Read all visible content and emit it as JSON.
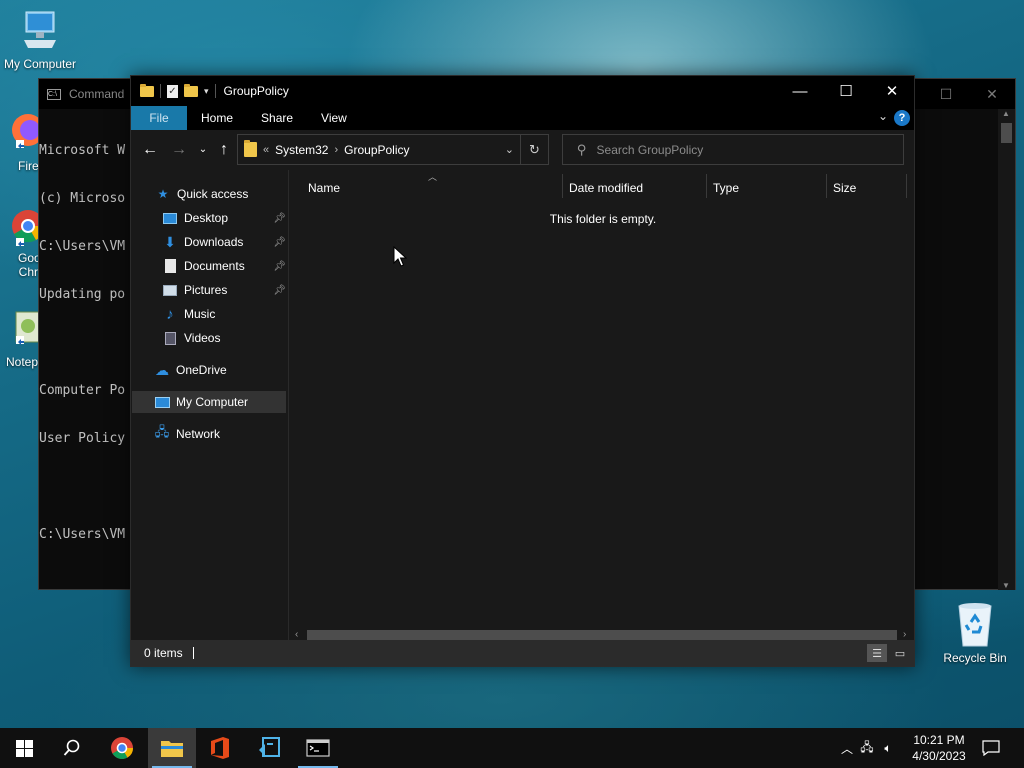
{
  "desktop": {
    "icons": [
      {
        "label": "My Computer"
      },
      {
        "label": "Fire"
      },
      {
        "label": "Goo"
      },
      {
        "label": "Chr"
      },
      {
        "label": "Notep"
      },
      {
        "label": "Recycle Bin"
      }
    ]
  },
  "cmd_window": {
    "title": "Command",
    "lines": [
      "Microsoft W",
      "(c) Microso",
      "C:\\Users\\VM",
      "Updating po",
      "",
      "Computer Po",
      "User Policy",
      "",
      "C:\\Users\\VM"
    ]
  },
  "explorer": {
    "title": "GroupPolicy",
    "ribbon_tabs": [
      "File",
      "Home",
      "Share",
      "View"
    ],
    "breadcrumb": {
      "overflow": "«",
      "items": [
        "System32",
        "GroupPolicy"
      ]
    },
    "search_placeholder": "Search GroupPolicy",
    "nav": {
      "quick_access": "Quick access",
      "pinned": [
        "Desktop",
        "Downloads",
        "Documents",
        "Pictures"
      ],
      "unpinned": [
        "Music",
        "Videos"
      ],
      "onedrive": "OneDrive",
      "my_computer": "My Computer",
      "network": "Network"
    },
    "columns": [
      "Name",
      "Date modified",
      "Type",
      "Size"
    ],
    "empty_message": "This folder is empty.",
    "status": "0 items"
  },
  "taskbar": {
    "apps": [
      "start",
      "search",
      "chrome",
      "file-explorer",
      "office",
      "visual-studio-code",
      "command-prompt"
    ],
    "time": "10:21 PM",
    "date": "4/30/2023"
  },
  "colors": {
    "ribbon_file": "#1979a9",
    "accent": "#76b9ed",
    "folder": "#f0c64a"
  }
}
